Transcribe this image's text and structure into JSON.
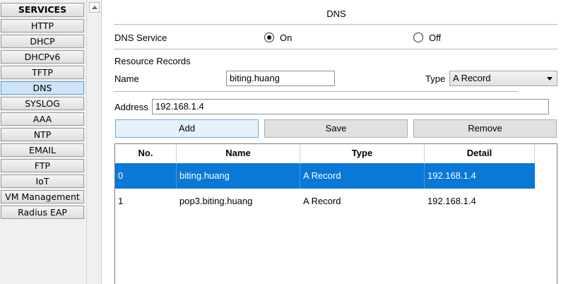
{
  "sidebar": {
    "header": "SERVICES",
    "items": [
      {
        "label": "HTTP",
        "selected": false
      },
      {
        "label": "DHCP",
        "selected": false
      },
      {
        "label": "DHCPv6",
        "selected": false
      },
      {
        "label": "TFTP",
        "selected": false
      },
      {
        "label": "DNS",
        "selected": true
      },
      {
        "label": "SYSLOG",
        "selected": false
      },
      {
        "label": "AAA",
        "selected": false
      },
      {
        "label": "NTP",
        "selected": false
      },
      {
        "label": "EMAIL",
        "selected": false
      },
      {
        "label": "FTP",
        "selected": false
      },
      {
        "label": "IoT",
        "selected": false
      },
      {
        "label": "VM Management",
        "selected": false
      },
      {
        "label": "Radius EAP",
        "selected": false
      }
    ]
  },
  "panel": {
    "title": "DNS",
    "service_label": "DNS Service",
    "on_label": "On",
    "off_label": "Off",
    "service_state": "on",
    "records_label": "Resource Records",
    "name_label": "Name",
    "name_value": "biting.huang",
    "type_label": "Type",
    "type_value": "A Record",
    "address_label": "Address",
    "address_value": "192.168.1.4",
    "add_label": "Add",
    "save_label": "Save",
    "remove_label": "Remove"
  },
  "table": {
    "headers": {
      "no": "No.",
      "name": "Name",
      "type": "Type",
      "detail": "Detail"
    },
    "rows": [
      {
        "no": "0",
        "name": "biting.huang",
        "type": "A Record",
        "detail": "192.168.1.4",
        "selected": true
      },
      {
        "no": "1",
        "name": "pop3.biting.huang",
        "type": "A Record",
        "detail": "192.168.1.4",
        "selected": false
      }
    ]
  },
  "colors": {
    "selection": "#0a78d7",
    "sidebar_selected": "#cde3f7"
  }
}
